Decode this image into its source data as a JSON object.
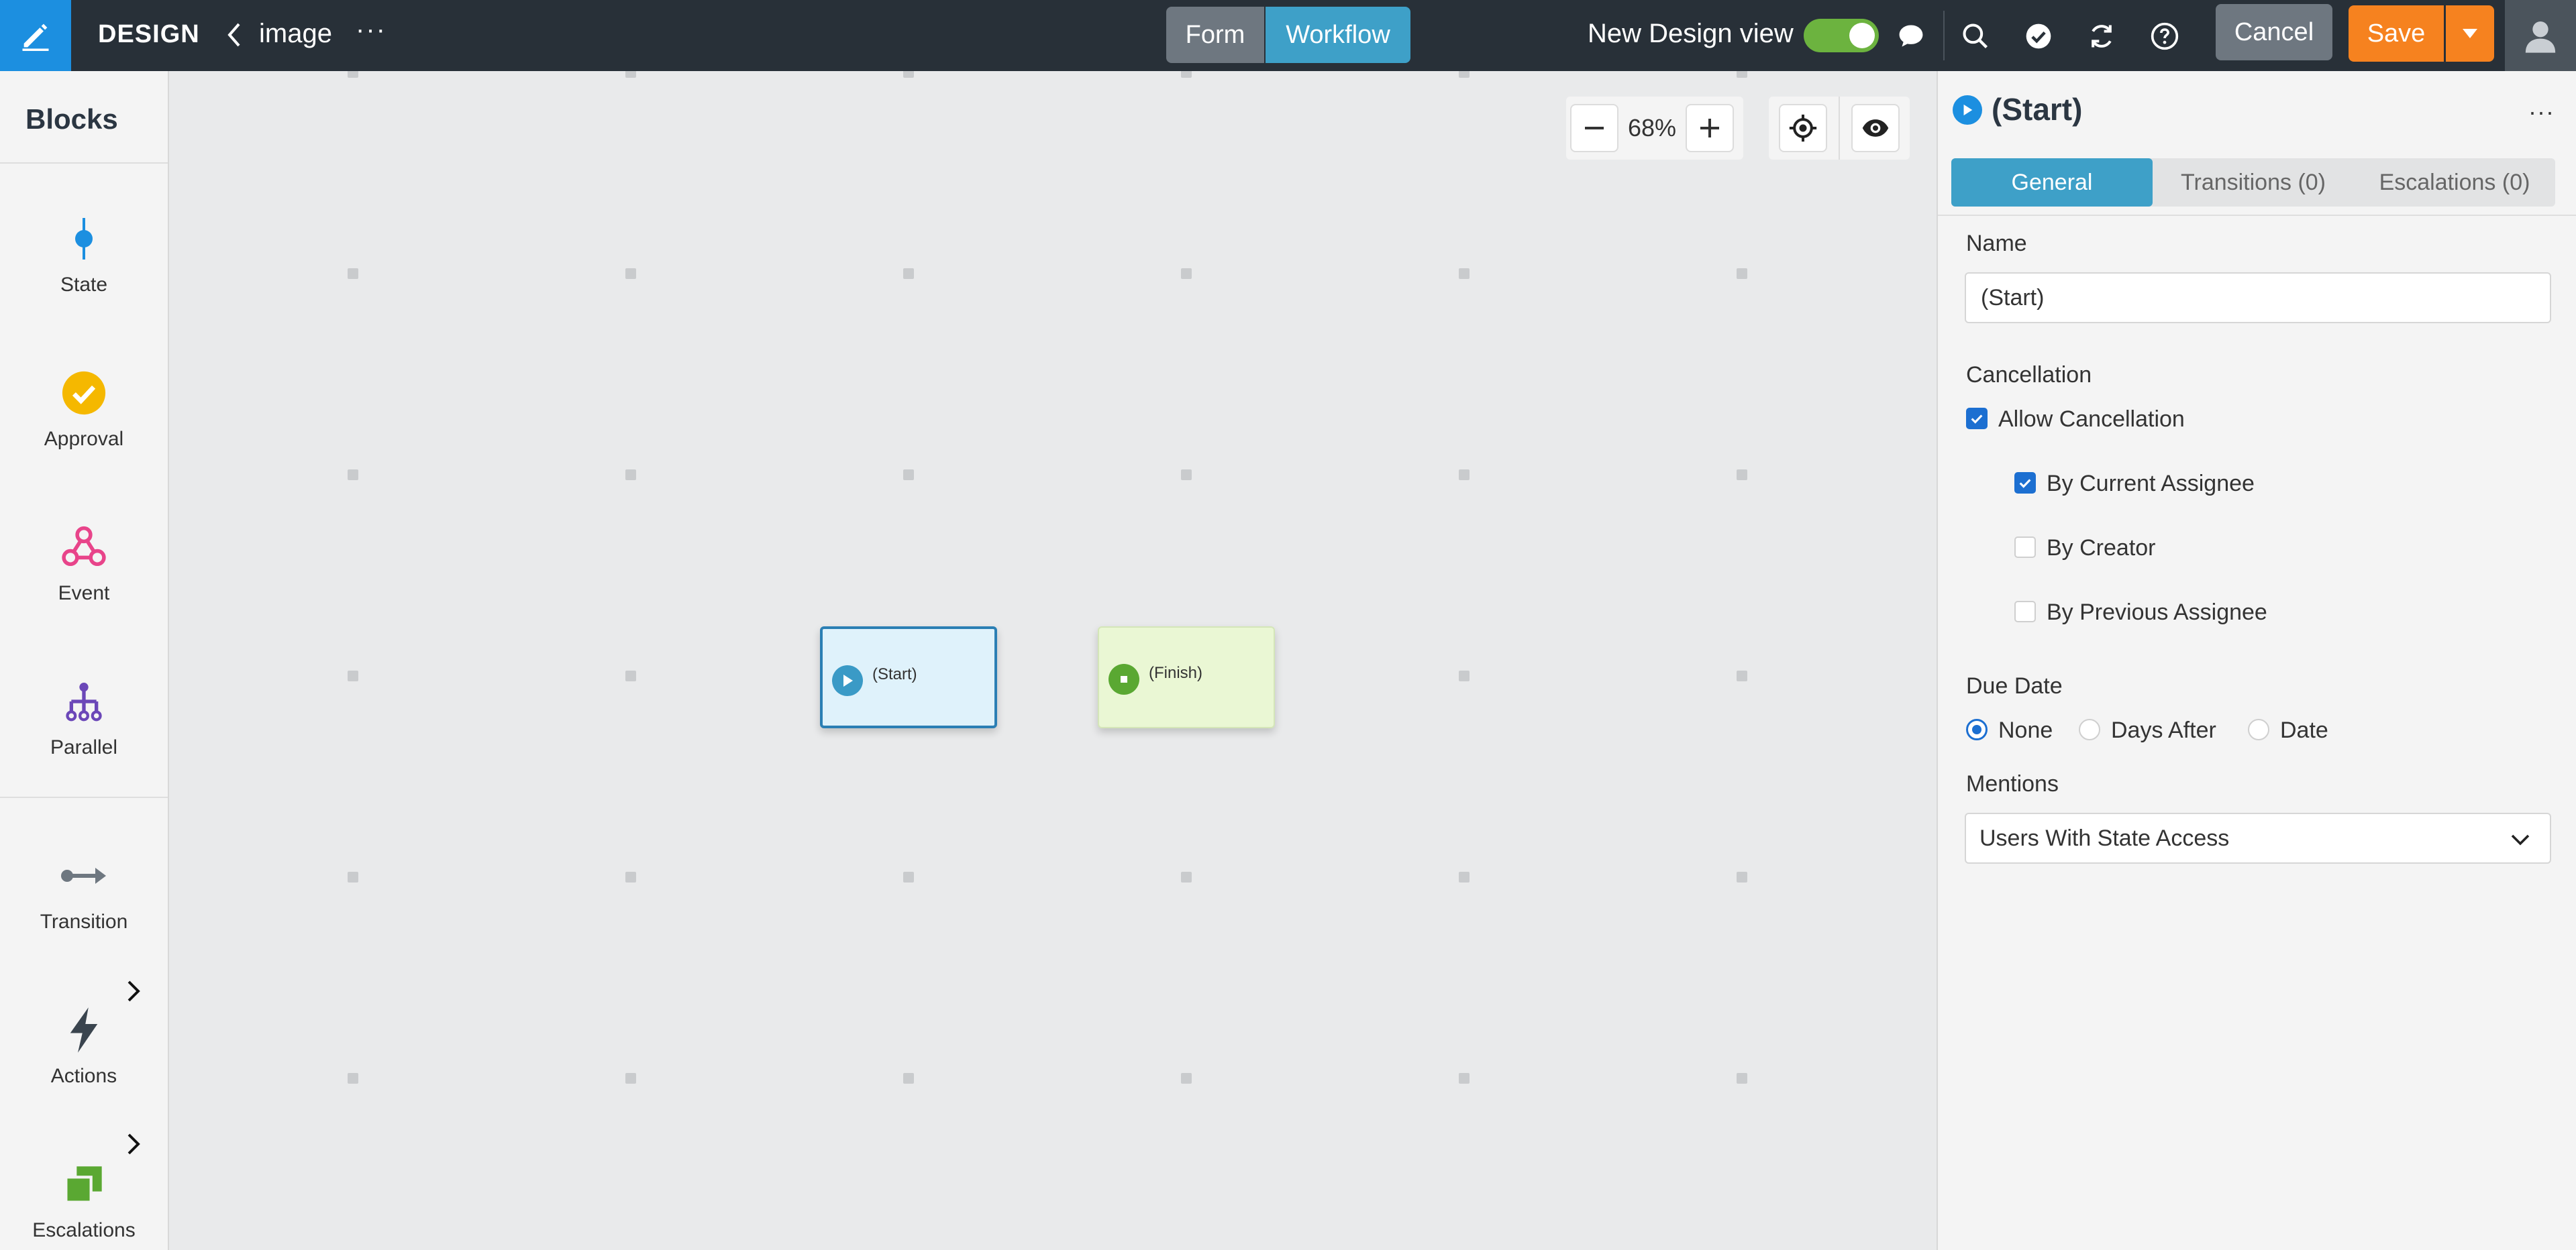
{
  "topbar": {
    "app_name": "DESIGN",
    "breadcrumb": "image",
    "more": "···",
    "tabs": [
      {
        "label": "Form",
        "active": false
      },
      {
        "label": "Workflow",
        "active": true
      }
    ],
    "new_design_view_label": "New Design view",
    "new_design_view_on": true,
    "icons": [
      "comment-icon",
      "search-icon",
      "check-circle-icon",
      "refresh-icon",
      "help-icon"
    ],
    "cancel_label": "Cancel",
    "save_label": "Save"
  },
  "blocks": {
    "title": "Blocks",
    "items": [
      {
        "label": "State",
        "icon": "state-icon"
      },
      {
        "label": "Approval",
        "icon": "approval-icon"
      },
      {
        "label": "Event",
        "icon": "event-icon"
      },
      {
        "label": "Parallel",
        "icon": "parallel-icon"
      },
      {
        "label": "Transition",
        "icon": "transition-icon"
      },
      {
        "label": "Actions",
        "icon": "lightning-icon"
      },
      {
        "label": "Escalations",
        "icon": "escalations-icon"
      }
    ]
  },
  "canvas": {
    "zoom": "68%",
    "nodes": [
      {
        "label": "(Start)",
        "type": "start"
      },
      {
        "label": "(Finish)",
        "type": "finish"
      }
    ]
  },
  "properties": {
    "title": "(Start)",
    "more": "···",
    "tabs": [
      {
        "label": "General",
        "active": true
      },
      {
        "label": "Transitions (0)",
        "active": false
      },
      {
        "label": "Escalations (0)",
        "active": false
      }
    ],
    "name_label": "Name",
    "name_value": "(Start)",
    "cancellation_label": "Cancellation",
    "allow_cancellation": {
      "label": "Allow Cancellation",
      "checked": true
    },
    "cancel_options": [
      {
        "label": "By Current Assignee",
        "checked": true
      },
      {
        "label": "By Creator",
        "checked": false
      },
      {
        "label": "By Previous Assignee",
        "checked": false
      }
    ],
    "due_date_label": "Due Date",
    "due_date_options": [
      {
        "label": "None",
        "selected": true
      },
      {
        "label": "Days After",
        "selected": false
      },
      {
        "label": "Date",
        "selected": false
      }
    ],
    "mentions_label": "Mentions",
    "mentions_value": "Users With State Access"
  },
  "colors": {
    "topbar_bg": "#283038",
    "accent_blue": "#1c8fe0",
    "workflow_tab": "#3ea0c8",
    "save_orange": "#f6821f",
    "toggle_green": "#6cb33f",
    "approval_yellow": "#f5b800",
    "event_pink": "#e8448a",
    "parallel_purple": "#6b47b8",
    "escalation_green": "#5aa832",
    "finish_green": "#5aa832"
  }
}
